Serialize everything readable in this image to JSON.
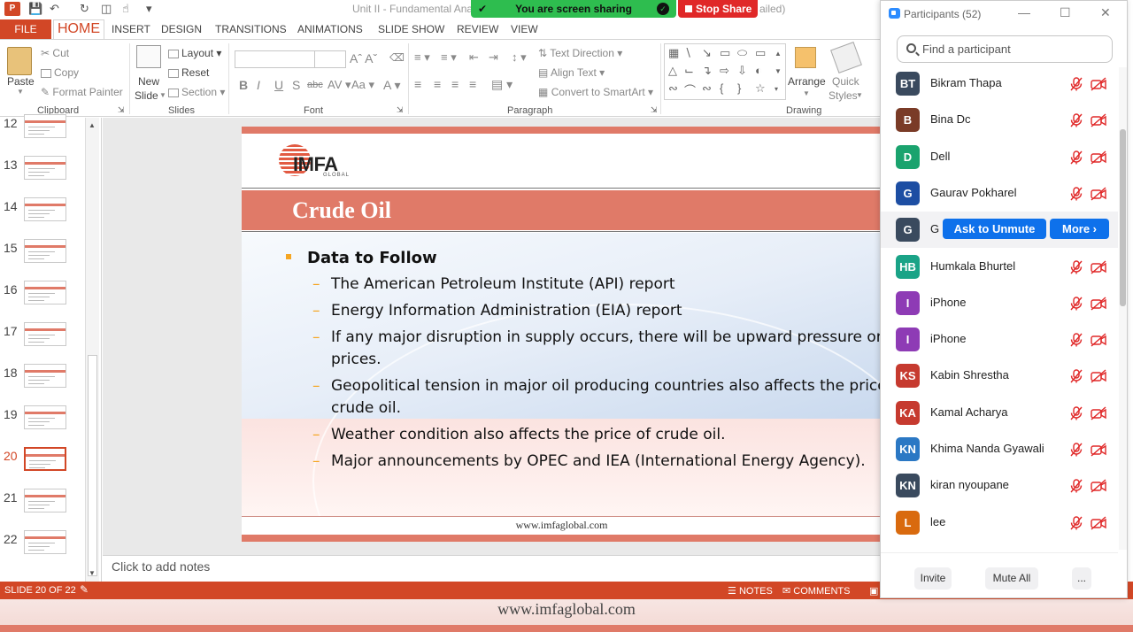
{
  "titlebar": {
    "doc_title": "Unit II - Fundamental Ana",
    "doc_title_end": "ailed)",
    "share_text": "You are screen sharing",
    "stop_share": "Stop Share"
  },
  "tabs": [
    "FILE",
    "HOME",
    "INSERT",
    "DESIGN",
    "TRANSITIONS",
    "ANIMATIONS",
    "SLIDE SHOW",
    "REVIEW",
    "VIEW"
  ],
  "ribbon": {
    "clipboard": {
      "paste": "Paste",
      "cut": "Cut",
      "copy": "Copy",
      "format_painter": "Format Painter",
      "label": "Clipboard"
    },
    "slides": {
      "new_slide_1": "New",
      "new_slide_2": "Slide",
      "layout": "Layout",
      "reset": "Reset",
      "section": "Section",
      "label": "Slides"
    },
    "font": {
      "label": "Font"
    },
    "paragraph": {
      "text_direction": "Text Direction",
      "align_text": "Align Text",
      "convert_smartart": "Convert to SmartArt",
      "label": "Paragraph"
    },
    "drawing": {
      "arrange": "Arrange",
      "quick_1": "Quick",
      "quick_2": "Styles",
      "label": "Drawing"
    }
  },
  "thumbnails": [
    "12",
    "13",
    "14",
    "15",
    "16",
    "17",
    "18",
    "19",
    "20",
    "21",
    "22"
  ],
  "active_slide": "20",
  "slide": {
    "logo": "IMFA",
    "logo_sub": "GLOBAL",
    "title": "Crude Oil",
    "main_bullet": "Data to Follow",
    "bullets": [
      {
        "line1": "The American Petroleum Institute (API) report",
        "line2": ""
      },
      {
        "line1": "Energy Information Administration (EIA) report",
        "line2": ""
      },
      {
        "line1": "If any major disruption in supply occurs, there will be upward pressure on",
        "line2": "prices."
      },
      {
        "line1": "Geopolitical tension in major oil producing countries also affects the price",
        "line2": "crude oil."
      },
      {
        "line1": "Weather condition also affects the price of crude oil.",
        "line2": ""
      },
      {
        "line1": "Major announcements by OPEC and IEA (International Energy Agency).",
        "line2": ""
      }
    ],
    "footer": "www.imfaglobal.com"
  },
  "notes_placeholder": "Click to add notes",
  "status": {
    "slide_count": "SLIDE 20 OF 22",
    "notes": "NOTES",
    "comments": "COMMENTS"
  },
  "bottom_url": "www.imfaglobal.com",
  "zoom": {
    "title": "Participants (52)",
    "search_placeholder": "Find a participant",
    "ask_unmute": "Ask to Unmute",
    "more": "More ›",
    "participants": [
      {
        "initials": "BT",
        "name": "Bikram Thapa",
        "color": "#3a4a5e"
      },
      {
        "initials": "B",
        "name": "Bina Dc",
        "color": "#7a3b27"
      },
      {
        "initials": "D",
        "name": "Dell",
        "color": "#1aa36e"
      },
      {
        "initials": "G",
        "name": "Gaurav Pokharel",
        "color": "#1d4ea3"
      },
      {
        "initials": "G",
        "name": "G",
        "color": "#3a4a5e"
      },
      {
        "initials": "HB",
        "name": "Humkala Bhurtel",
        "color": "#1aa387"
      },
      {
        "initials": "I",
        "name": "iPhone",
        "color": "#8e3bb5"
      },
      {
        "initials": "I",
        "name": "iPhone",
        "color": "#8e3bb5"
      },
      {
        "initials": "KS",
        "name": "Kabin Shrestha",
        "color": "#c63a2f"
      },
      {
        "initials": "KA",
        "name": "Kamal Acharya",
        "color": "#c63a2f"
      },
      {
        "initials": "KN",
        "name": "Khima Nanda Gyawali",
        "color": "#2b78c4"
      },
      {
        "initials": "KN",
        "name": "kiran nyoupane",
        "color": "#3a4a5e"
      },
      {
        "initials": "L",
        "name": "lee",
        "color": "#d96a0e"
      }
    ],
    "invite": "Invite",
    "mute_all": "Mute All",
    "more_menu": "..."
  }
}
